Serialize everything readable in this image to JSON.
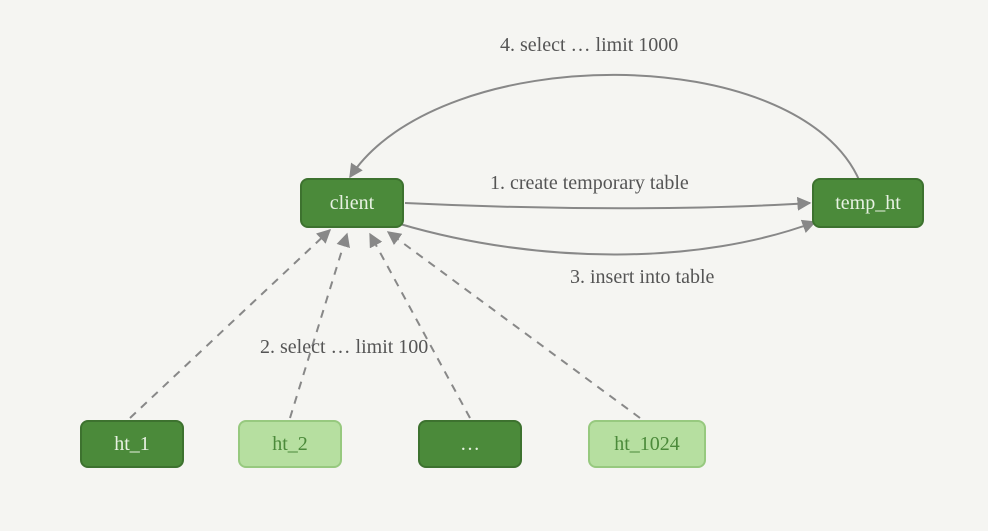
{
  "nodes": {
    "client": {
      "label": "client"
    },
    "temp_ht": {
      "label": "temp_ht"
    },
    "ht_1": {
      "label": "ht_1"
    },
    "ht_2": {
      "label": "ht_2"
    },
    "dots": {
      "label": "…"
    },
    "ht_1024": {
      "label": "ht_1024"
    }
  },
  "edges": {
    "step1": {
      "label": "1. create temporary table"
    },
    "step2": {
      "label": "2. select … limit 100"
    },
    "step3": {
      "label": "3. insert into table"
    },
    "step4": {
      "label": "4. select … limit 1000"
    }
  },
  "colors": {
    "dark_fill": "#4b8a3a",
    "light_fill": "#b6dfa0",
    "stroke": "#888888",
    "bg": "#f5f5f2"
  }
}
